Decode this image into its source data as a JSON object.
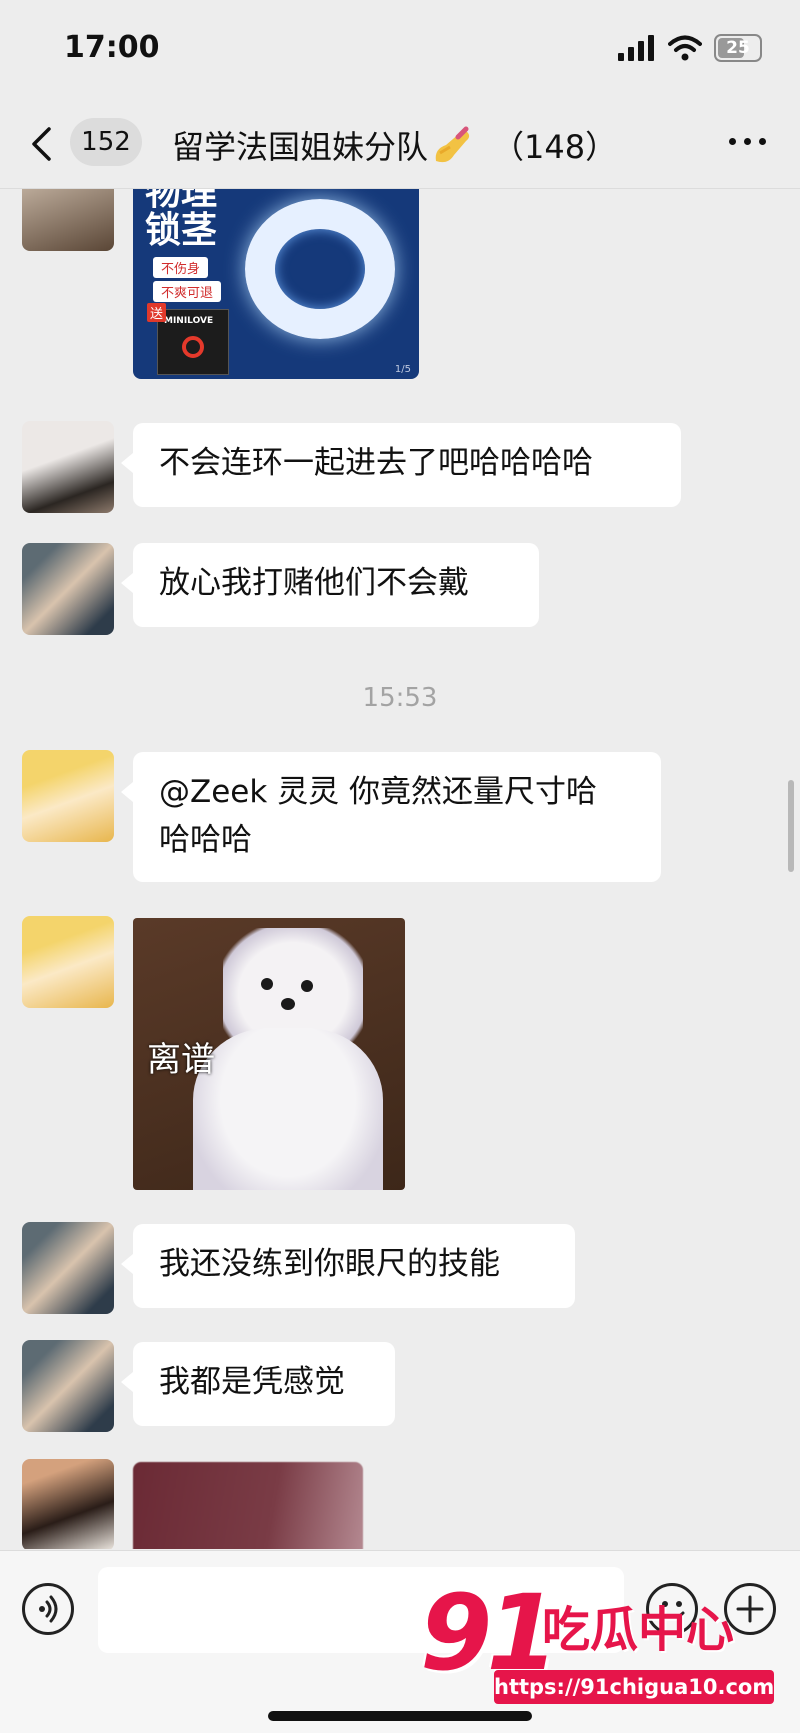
{
  "status": {
    "time": "17:00",
    "battery": "25"
  },
  "header": {
    "back_count": "152",
    "title": "留学法国姐妹分队",
    "member_count": "（148）"
  },
  "messages": {
    "product_image": {
      "line1": "物理",
      "line2": "锁茎",
      "tag1": "不伤身",
      "tag2": "不爽可退",
      "brand": "MINILOVE",
      "gift": "送",
      "page": "1/5"
    },
    "m1": "不会连环一起进去了吧哈哈哈哈",
    "m2": "放心我打赌他们不会戴",
    "timestamp": "15:53",
    "m3_line1": "@Zeek 灵灵 你竟然还量尺寸哈",
    "m3_line2": "哈哈哈",
    "sticker_caption": "离谱",
    "m4": "我还没练到你眼尺的技能",
    "m5": "我都是凭感觉"
  },
  "watermark": {
    "logo": "91",
    "name": "吃瓜中心",
    "url": "https://91chigua10.com"
  },
  "colors": {
    "background": "#ededed",
    "bubble": "#ffffff",
    "watermark_red": "#e6154a"
  }
}
